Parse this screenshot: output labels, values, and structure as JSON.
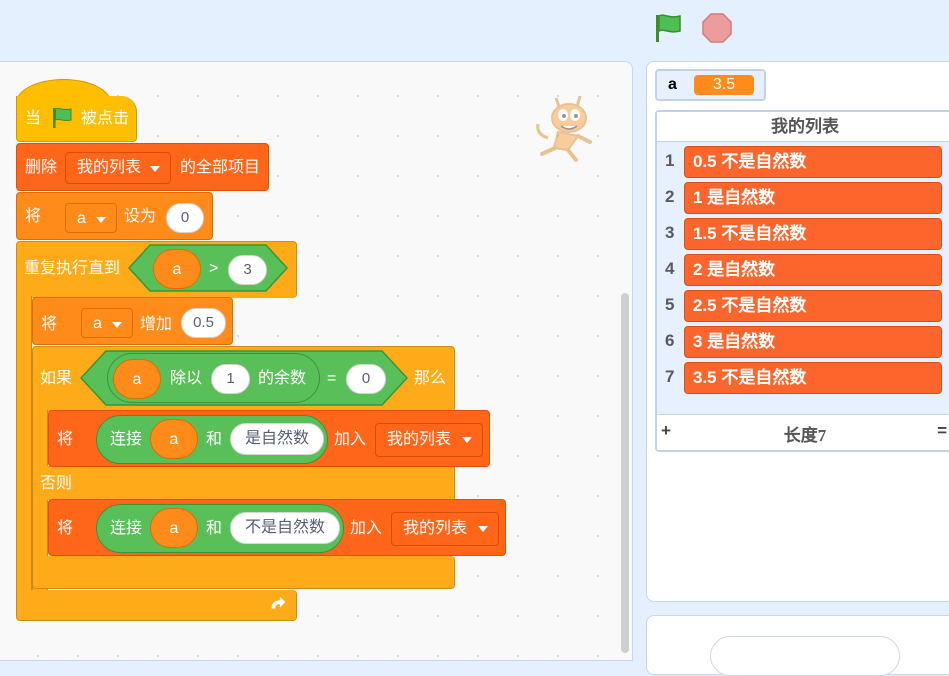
{
  "controls": {
    "green_flag_icon": "green-flag-icon",
    "stop_icon": "stop-icon"
  },
  "colors": {
    "events": "#ffbf00",
    "control": "#ffab19",
    "variables": "#ff8c1a",
    "lists": "#ff661a",
    "operators": "#59c059",
    "background": "#e5f0ff"
  },
  "script": {
    "hat": {
      "when": "当",
      "clicked": "被点击"
    },
    "delete_all": {
      "label": "删除",
      "list": "我的列表",
      "suffix": "的全部项目"
    },
    "set_var": {
      "label": "将",
      "var": "a",
      "to": "设为",
      "value": "0"
    },
    "repeat_until": {
      "label": "重复执行直到",
      "var": "a",
      "op": ">",
      "value": "3"
    },
    "change_var": {
      "label": "将",
      "var": "a",
      "by": "增加",
      "value": "0.5"
    },
    "if_else": {
      "if": "如果",
      "var": "a",
      "mod": "除以",
      "divisor": "1",
      "remainder": "的余数",
      "eq": "=",
      "value": "0",
      "then": "那么",
      "else": "否则"
    },
    "add_natural": {
      "label": "将",
      "join": "连接",
      "var": "a",
      "and": "和",
      "text": "是自然数",
      "add_to": "加入",
      "list": "我的列表"
    },
    "add_not_natural": {
      "label": "将",
      "join": "连接",
      "var": "a",
      "and": "和",
      "text": "不是自然数",
      "add_to": "加入",
      "list": "我的列表"
    }
  },
  "monitors": {
    "variable": {
      "name": "a",
      "value": "3.5"
    },
    "list": {
      "title": "我的列表",
      "items": [
        {
          "index": "1",
          "value": "0.5 不是自然数"
        },
        {
          "index": "2",
          "value": "1 是自然数"
        },
        {
          "index": "3",
          "value": "1.5 不是自然数"
        },
        {
          "index": "4",
          "value": "2 是自然数"
        },
        {
          "index": "5",
          "value": "2.5 不是自然数"
        },
        {
          "index": "6",
          "value": "3 是自然数"
        },
        {
          "index": "7",
          "value": "3.5 不是自然数"
        }
      ],
      "add": "+",
      "length": "长度7",
      "resize": "="
    }
  }
}
